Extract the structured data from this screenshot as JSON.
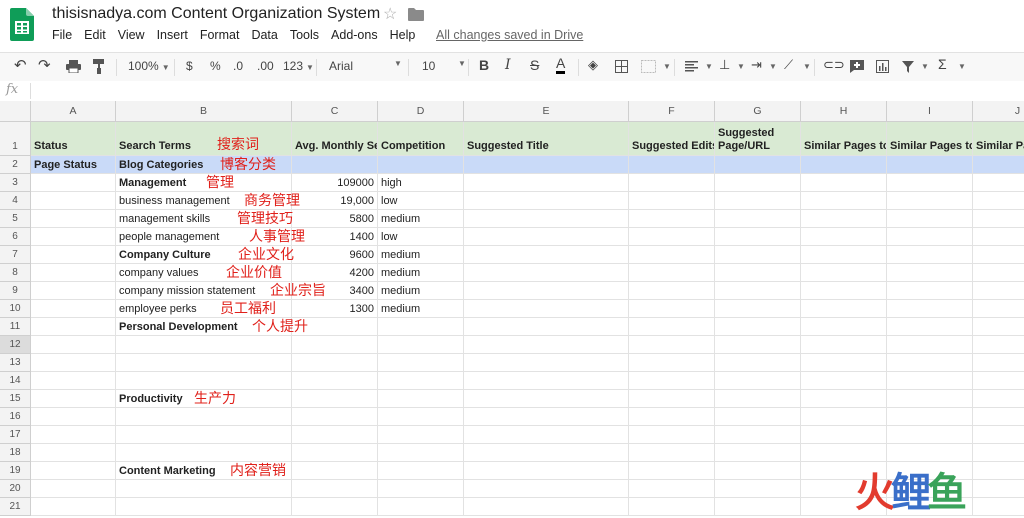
{
  "app": {
    "title": "thisisnadya.com Content Organization System",
    "saved_status": "All changes saved in Drive",
    "menu": [
      "File",
      "Edit",
      "View",
      "Insert",
      "Format",
      "Data",
      "Tools",
      "Add-ons",
      "Help"
    ]
  },
  "toolbar": {
    "zoom": "100%",
    "currency": "$",
    "percent": "%",
    "decimal_decrease": ".0",
    "decimal_increase": ".00",
    "more_formats": "123",
    "font": "Arial",
    "font_size": "10",
    "bold": "B",
    "italic": "I",
    "strike": "S",
    "text_color": "A",
    "sum": "Σ"
  },
  "formula_bar": {
    "label": "fx",
    "value": ""
  },
  "columns": [
    "A",
    "B",
    "C",
    "D",
    "E",
    "F",
    "G",
    "H",
    "I",
    "J"
  ],
  "rows": [
    {
      "num": "1",
      "style": "header",
      "cells": {
        "A": "Status",
        "B": "Search Terms",
        "C": "Avg. Monthly Searches",
        "D": "Competition",
        "E": "Suggested Title",
        "F": "Suggested Edits",
        "G": "Suggested Page/URL",
        "H": "Similar Pages to",
        "I": "Similar Pages to",
        "J": "Similar Pages"
      },
      "zh": "搜索词"
    },
    {
      "num": "2",
      "style": "blue",
      "cells": {
        "A": "Page Status",
        "B": "Blog Categories"
      },
      "zh": "博客分类"
    },
    {
      "num": "3",
      "cells": {
        "B": "Management",
        "C": "109000",
        "D": "high"
      },
      "bold": true,
      "zh": "管理"
    },
    {
      "num": "4",
      "cells": {
        "B": "business management",
        "C": "19,000",
        "D": "low"
      },
      "zh": "商务管理"
    },
    {
      "num": "5",
      "cells": {
        "B": "management skills",
        "C": "5800",
        "D": "medium"
      },
      "zh": "管理技巧"
    },
    {
      "num": "6",
      "cells": {
        "B": "people management",
        "C": "1400",
        "D": "low"
      },
      "zh": "人事管理"
    },
    {
      "num": "7",
      "cells": {
        "B": "Company Culture",
        "C": "9600",
        "D": "medium"
      },
      "bold": true,
      "zh": "企业文化"
    },
    {
      "num": "8",
      "cells": {
        "B": "company values",
        "C": "4200",
        "D": "medium"
      },
      "zh": "企业价值"
    },
    {
      "num": "9",
      "cells": {
        "B": "company mission statement",
        "C": "3400",
        "D": "medium"
      },
      "zh": "企业宗旨"
    },
    {
      "num": "10",
      "cells": {
        "B": "employee perks",
        "C": "1300",
        "D": "medium"
      },
      "zh": "员工福利"
    },
    {
      "num": "11",
      "cells": {
        "B": "Personal Development"
      },
      "bold": true,
      "zh": "个人提升"
    },
    {
      "num": "12",
      "cells": {},
      "selected": true
    },
    {
      "num": "13",
      "cells": {}
    },
    {
      "num": "14",
      "cells": {}
    },
    {
      "num": "15",
      "cells": {
        "B": "Productivity"
      },
      "bold": true,
      "zh": "生产力"
    },
    {
      "num": "16",
      "cells": {}
    },
    {
      "num": "17",
      "cells": {}
    },
    {
      "num": "18",
      "cells": {}
    },
    {
      "num": "19",
      "cells": {
        "B": "Content Marketing"
      },
      "bold": true,
      "zh": "内容营销"
    },
    {
      "num": "20",
      "cells": {}
    },
    {
      "num": "21",
      "cells": {}
    }
  ],
  "watermark": {
    "text": "火鲤鱼",
    "colors": [
      "#e23b2e",
      "#3a6fc9",
      "#3aa35a"
    ]
  }
}
